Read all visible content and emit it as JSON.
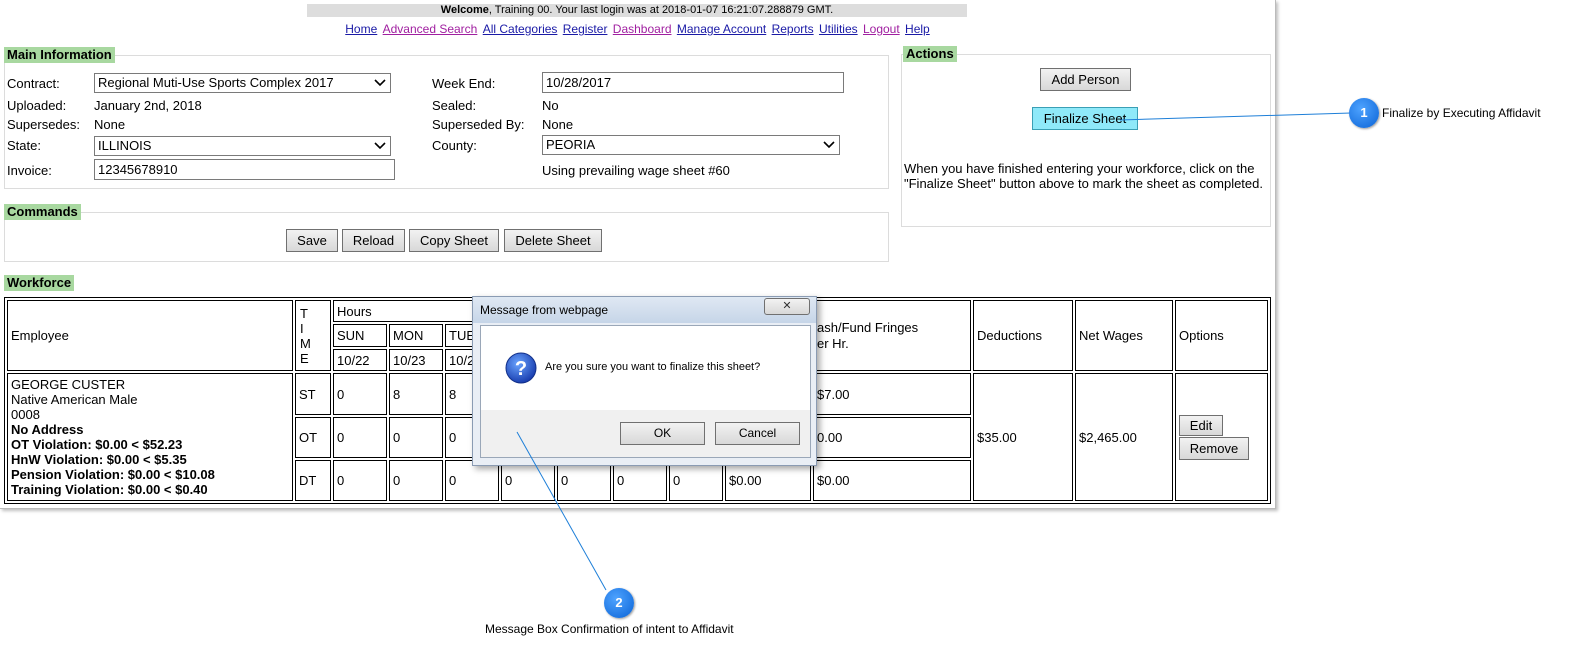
{
  "header": {
    "welcome_bold": "Welcome",
    "welcome_rest": ", Training 00. Your last login was at 2018-01-07 16:21:07.288879 GMT."
  },
  "nav": {
    "items": [
      "Home",
      "Advanced Search",
      "All Categories",
      "Register",
      "Dashboard",
      "Manage Account",
      "Reports",
      "Utilities",
      "Logout",
      "Help"
    ]
  },
  "main_info": {
    "title": "Main Information",
    "contract_label": "Contract:",
    "contract_value": "Regional Muti-Use Sports Complex 2017",
    "uploaded_label": "Uploaded:",
    "uploaded_value": "January 2nd, 2018",
    "supersedes_label": "Supersedes:",
    "supersedes_value": "None",
    "state_label": "State:",
    "state_value": "ILLINOIS",
    "invoice_label": "Invoice:",
    "invoice_value": "12345678910",
    "weekend_label": "Week End:",
    "weekend_value": "10/28/2017",
    "sealed_label": "Sealed:",
    "sealed_value": "No",
    "superseded_by_label": "Superseded By:",
    "superseded_by_value": "None",
    "county_label": "County:",
    "county_value": "PEORIA",
    "wage_sheet_note": "Using prevailing wage sheet #60"
  },
  "commands": {
    "title": "Commands",
    "save": "Save",
    "reload": "Reload",
    "copy": "Copy Sheet",
    "delete": "Delete Sheet"
  },
  "actions": {
    "title": "Actions",
    "add_person": "Add Person",
    "finalize": "Finalize Sheet",
    "help_text": "When you have finished entering your workforce, click on the \"Finalize Sheet\" button above to mark the sheet as completed."
  },
  "workforce": {
    "title": "Workforce",
    "headers": {
      "employee": "Employee",
      "time": [
        "T",
        "I",
        "M",
        "E"
      ],
      "hours": "Hours",
      "days": [
        "SUN",
        "MON",
        "TUE"
      ],
      "dates": [
        "10/22",
        "10/23",
        "10/2"
      ],
      "cash_fringes": "ash/Fund Fringes",
      "per_hr": "er Hr.",
      "deductions": "Deductions",
      "net_wages": "Net Wages",
      "options": "Options"
    },
    "employee": {
      "name": "GEORGE CUSTER",
      "ethnicity": "Native American Male",
      "id": "0008",
      "address": "No Address",
      "violations": [
        "OT Violation: $0.00 < $52.23",
        "HnW Violation: $0.00 < $5.35",
        "Pension Violation: $0.00 < $10.08",
        "Training Violation: $0.00 < $0.40"
      ]
    },
    "rows": [
      {
        "type": "ST",
        "sun": "0",
        "mon": "8",
        "tue": "8",
        "wed": "",
        "thu": "",
        "fri": "",
        "sat": "",
        "rate": "",
        "fringe": "$7.00"
      },
      {
        "type": "OT",
        "sun": "0",
        "mon": "0",
        "tue": "0",
        "wed": "",
        "thu": "",
        "fri": "",
        "sat": "",
        "rate": "",
        "fringe": "0.00"
      },
      {
        "type": "DT",
        "sun": "0",
        "mon": "0",
        "tue": "0",
        "wed": "0",
        "thu": "0",
        "fri": "0",
        "sat": "0",
        "rate": "$0.00",
        "fringe": "$0.00"
      }
    ],
    "deductions": "$35.00",
    "net_wages": "$2,465.00",
    "edit": "Edit",
    "remove": "Remove"
  },
  "dialog": {
    "title": "Message from webpage",
    "message": "Are you sure you want to finalize this sheet?",
    "ok": "OK",
    "cancel": "Cancel",
    "close_glyph": "✕"
  },
  "callouts": [
    {
      "number": "1",
      "text": "Finalize by Executing Affidavit"
    },
    {
      "number": "2",
      "text": "Message Box Confirmation of intent to Affidavit"
    }
  ],
  "colors": {
    "legend_bg": "#a8d8a0",
    "link": "#1a1aa6",
    "visited_link": "#a01fa0",
    "finalize_highlight": "#8fe9f9",
    "callout_blue": "#0a63d6"
  }
}
